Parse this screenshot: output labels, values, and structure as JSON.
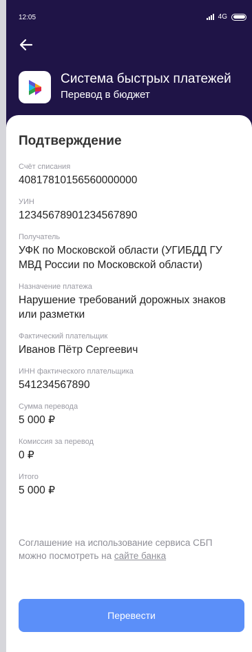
{
  "status_bar": {
    "time": "12:05",
    "network": "4G"
  },
  "header": {
    "title": "Система быстрых платежей",
    "subtitle": "Перевод в бюджет"
  },
  "confirmation": {
    "title": "Подтверждение",
    "fields": [
      {
        "label": "Счёт списания",
        "value": "40817810156560000000"
      },
      {
        "label": "УИН",
        "value": "12345678901234567890"
      },
      {
        "label": "Получатель",
        "value": "УФК по Московской области (УГИБДД ГУ МВД России по Московской области)"
      },
      {
        "label": "Назначение платежа",
        "value": "Нарушение требований дорожных знаков или разметки"
      },
      {
        "label": "Фактический плательщик",
        "value": "Иванов Пётр Сергеевич"
      },
      {
        "label": "ИНН фактического плательщика",
        "value": "541234567890"
      },
      {
        "label": "Сумма перевода",
        "value": "5 000 ₽"
      },
      {
        "label": "Комиссия за перевод",
        "value": "0 ₽"
      },
      {
        "label": "Итого",
        "value": "5 000 ₽"
      }
    ]
  },
  "agreement": {
    "text": "Соглашение на использование сервиса СБП можно посмотреть на",
    "link": "сайте банка"
  },
  "actions": {
    "submit_label": "Перевести"
  },
  "colors": {
    "header_bg": "#1f1447",
    "button_bg": "#5b8ff9"
  }
}
